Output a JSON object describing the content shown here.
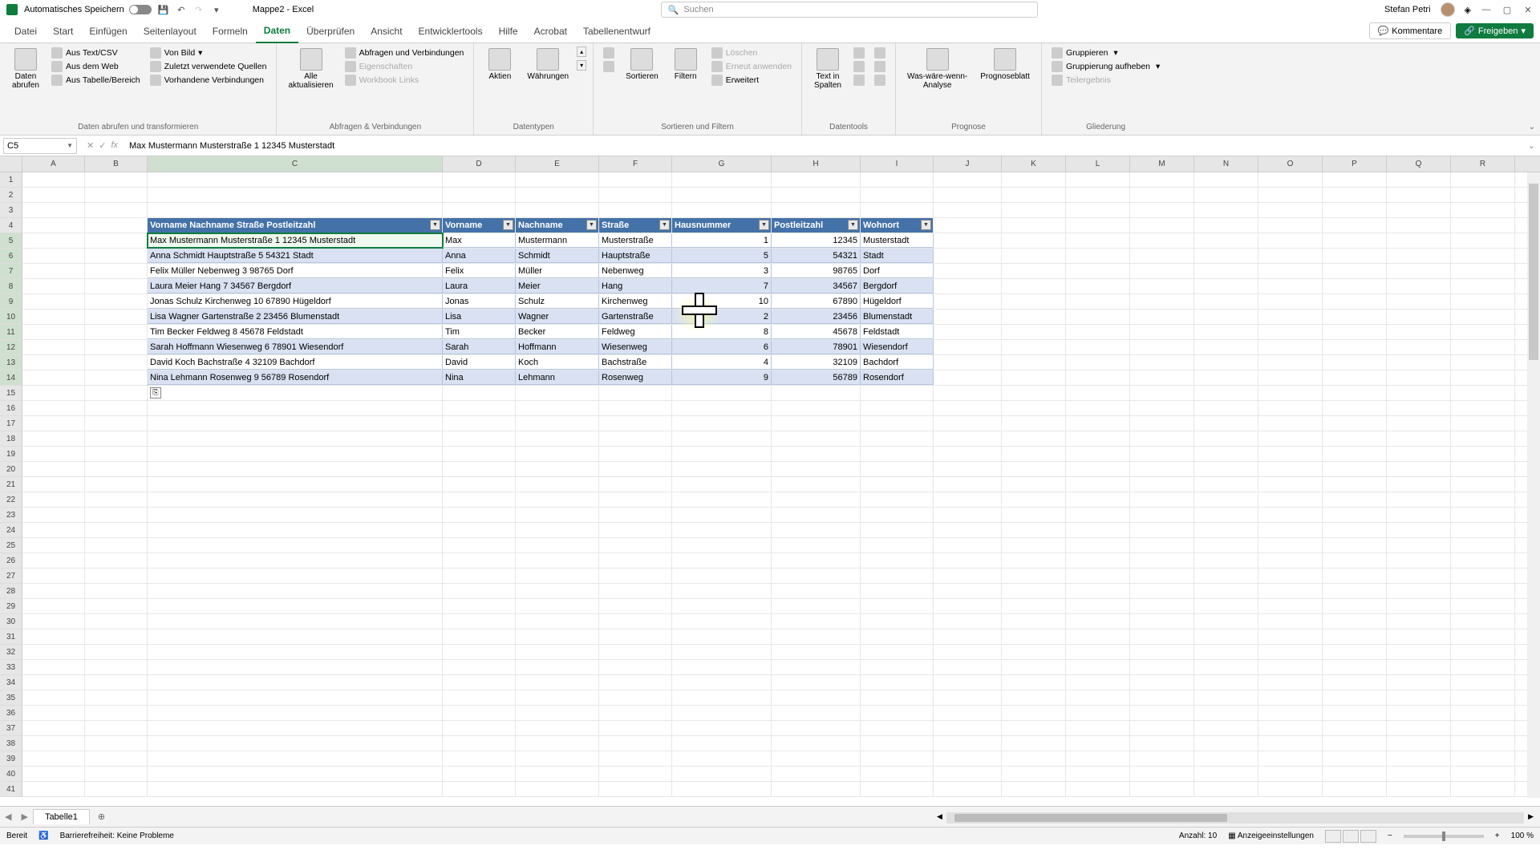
{
  "titlebar": {
    "autosave": "Automatisches Speichern",
    "doc_title": "Mappe2 - Excel",
    "search_placeholder": "Suchen",
    "user": "Stefan Petri"
  },
  "tabs": {
    "items": [
      "Datei",
      "Start",
      "Einfügen",
      "Seitenlayout",
      "Formeln",
      "Daten",
      "Überprüfen",
      "Ansicht",
      "Entwicklertools",
      "Hilfe",
      "Acrobat",
      "Tabellenentwurf"
    ],
    "active": "Daten",
    "kommentare": "Kommentare",
    "freigeben": "Freigeben"
  },
  "ribbon": {
    "g1": {
      "daten_abrufen": "Daten\nabrufen",
      "aus_text": "Aus Text/CSV",
      "von_bild": "Von Bild",
      "aus_web": "Aus dem Web",
      "zuletzt": "Zuletzt verwendete Quellen",
      "aus_tabelle": "Aus Tabelle/Bereich",
      "vorhandene": "Vorhandene Verbindungen",
      "label": "Daten abrufen und transformieren"
    },
    "g2": {
      "alle_akt": "Alle\naktualisieren",
      "abfragen": "Abfragen und Verbindungen",
      "eigenschaften": "Eigenschaften",
      "workbook": "Workbook Links",
      "label": "Abfragen & Verbindungen"
    },
    "g3": {
      "aktien": "Aktien",
      "waehrungen": "Währungen",
      "label": "Datentypen"
    },
    "g4": {
      "sortieren": "Sortieren",
      "filtern": "Filtern",
      "loeschen": "Löschen",
      "erneut": "Erneut anwenden",
      "erweitert": "Erweitert",
      "label": "Sortieren und Filtern"
    },
    "g5": {
      "text_in": "Text in\nSpalten",
      "label": "Datentools"
    },
    "g6": {
      "was_waere": "Was-wäre-wenn-\nAnalyse",
      "prognose": "Prognoseblatt",
      "label": "Prognose"
    },
    "g7": {
      "gruppieren": "Gruppieren",
      "aufheben": "Gruppierung aufheben",
      "teilergebnis": "Teilergebnis",
      "label": "Gliederung"
    }
  },
  "fbar": {
    "cellref": "C5",
    "formula": "Max Mustermann Musterstraße 1 12345 Musterstadt"
  },
  "columns": [
    "A",
    "B",
    "C",
    "D",
    "E",
    "F",
    "G",
    "H",
    "I",
    "J",
    "K",
    "L",
    "M",
    "N",
    "O",
    "P",
    "Q",
    "R"
  ],
  "table": {
    "headers": [
      "Vorname Nachname Straße Postleitzahl",
      "Vorname",
      "Nachname",
      "Straße",
      "Hausnummer",
      "Postleitzahl",
      "Wohnort"
    ],
    "rows": [
      {
        "full": "Max Mustermann Musterstraße 1 12345 Musterstadt",
        "vor": "Max",
        "nach": "Mustermann",
        "str": "Musterstraße",
        "hnr": "1",
        "plz": "12345",
        "ort": "Musterstadt"
      },
      {
        "full": "Anna Schmidt Hauptstraße 5 54321 Stadt",
        "vor": "Anna",
        "nach": "Schmidt",
        "str": "Hauptstraße",
        "hnr": "5",
        "plz": "54321",
        "ort": "Stadt"
      },
      {
        "full": "Felix Müller Nebenweg 3 98765 Dorf",
        "vor": "Felix",
        "nach": "Müller",
        "str": "Nebenweg",
        "hnr": "3",
        "plz": "98765",
        "ort": "Dorf"
      },
      {
        "full": "Laura Meier Hang 7 34567 Bergdorf",
        "vor": "Laura",
        "nach": "Meier",
        "str": "Hang",
        "hnr": "7",
        "plz": "34567",
        "ort": "Bergdorf"
      },
      {
        "full": "Jonas Schulz Kirchenweg 10 67890 Hügeldorf",
        "vor": "Jonas",
        "nach": "Schulz",
        "str": "Kirchenweg",
        "hnr": "10",
        "plz": "67890",
        "ort": "Hügeldorf"
      },
      {
        "full": "Lisa Wagner Gartenstraße 2 23456 Blumenstadt",
        "vor": "Lisa",
        "nach": "Wagner",
        "str": "Gartenstraße",
        "hnr": "2",
        "plz": "23456",
        "ort": "Blumenstadt"
      },
      {
        "full": "Tim Becker Feldweg 8 45678 Feldstadt",
        "vor": "Tim",
        "nach": "Becker",
        "str": "Feldweg",
        "hnr": "8",
        "plz": "45678",
        "ort": "Feldstadt"
      },
      {
        "full": "Sarah Hoffmann Wiesenweg 6 78901 Wiesendorf",
        "vor": "Sarah",
        "nach": "Hoffmann",
        "str": "Wiesenweg",
        "hnr": "6",
        "plz": "78901",
        "ort": "Wiesendorf"
      },
      {
        "full": "David Koch Bachstraße 4 32109 Bachdorf",
        "vor": "David",
        "nach": "Koch",
        "str": "Bachstraße",
        "hnr": "4",
        "plz": "32109",
        "ort": "Bachdorf"
      },
      {
        "full": "Nina Lehmann Rosenweg 9 56789 Rosendorf",
        "vor": "Nina",
        "nach": "Lehmann",
        "str": "Rosenweg",
        "hnr": "9",
        "plz": "56789",
        "ort": "Rosendorf"
      }
    ]
  },
  "sheet": {
    "name": "Tabelle1"
  },
  "status": {
    "bereit": "Bereit",
    "barrierefreiheit": "Barrierefreiheit: Keine Probleme",
    "anzahl": "Anzahl: 10",
    "anzeige": "Anzeigeeinstellungen",
    "zoom": "100 %"
  }
}
